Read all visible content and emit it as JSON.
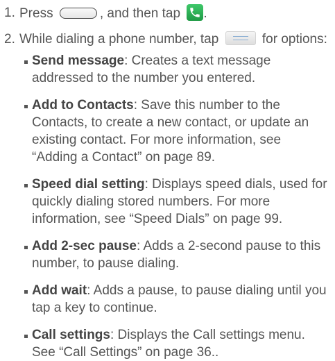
{
  "steps": [
    {
      "number": "1.",
      "parts": [
        "Press",
        ", and then tap",
        "."
      ],
      "icons": [
        "home-key-icon",
        "phone-app-icon"
      ]
    },
    {
      "number": "2.",
      "parts": [
        "While dialing a phone number, tap",
        "for options:"
      ],
      "icons": [
        "menu-key-icon"
      ]
    }
  ],
  "options": [
    {
      "term": "Send message",
      "description": ": Creates a text message addressed to the number you entered."
    },
    {
      "term": "Add to Contacts",
      "description": ": Save this number to the Contacts, to create a new contact, or update an existing contact. For more information, see “Adding a Contact” on page 89."
    },
    {
      "term": "Speed dial setting",
      "description": ": Displays speed dials, used for quickly dialing stored numbers. For more information, see “Speed Dials” on page 99."
    },
    {
      "term": "Add 2-sec pause",
      "description": ": Adds a 2-second pause to this number, to pause dialing."
    },
    {
      "term": "Add wait",
      "description": ": Adds a pause, to pause dialing until you tap a key to continue."
    },
    {
      "term": "Call settings",
      "description": ": Displays the Call settings menu. See “Call Settings” on page 36.."
    }
  ],
  "colors": {
    "text": "#555555",
    "phone_icon": "#2bb356",
    "menu_lines": "#8aaed3"
  }
}
